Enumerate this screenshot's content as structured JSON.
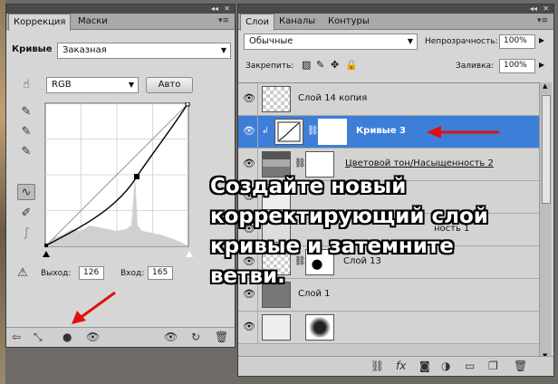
{
  "adjustments_panel": {
    "tabs": [
      {
        "label": "Коррекция"
      },
      {
        "label": "Маски"
      }
    ],
    "adjustment_name": "Кривые",
    "preset_value": "Заказная",
    "channel_value": "RGB",
    "auto_label": "Авто",
    "output_label": "Выход:",
    "output_value": "126",
    "input_label": "Вход:",
    "input_value": "165"
  },
  "layers_panel": {
    "tabs": [
      {
        "label": "Слои"
      },
      {
        "label": "Каналы"
      },
      {
        "label": "Контуры"
      }
    ],
    "blend_mode": "Обычные",
    "opacity_label": "Непрозрачность:",
    "opacity_value": "100%",
    "lock_label": "Закрепить:",
    "fill_label": "Заливка:",
    "fill_value": "100%",
    "layers": [
      {
        "name": "Слой 14 копия"
      },
      {
        "name": "Кривые 3"
      },
      {
        "name": "Цветовой тон/Насыщенность 2"
      },
      {
        "name": "ность 1"
      },
      {
        "name": "Слой 13"
      },
      {
        "name": "Слой 1"
      }
    ]
  },
  "overlay": {
    "caption": "Создайте новый\nкорректирующий слой\nкривые и затемните\nветви."
  },
  "colors": {
    "highlight": "#3d7fd8",
    "arrow": "#e01010"
  }
}
